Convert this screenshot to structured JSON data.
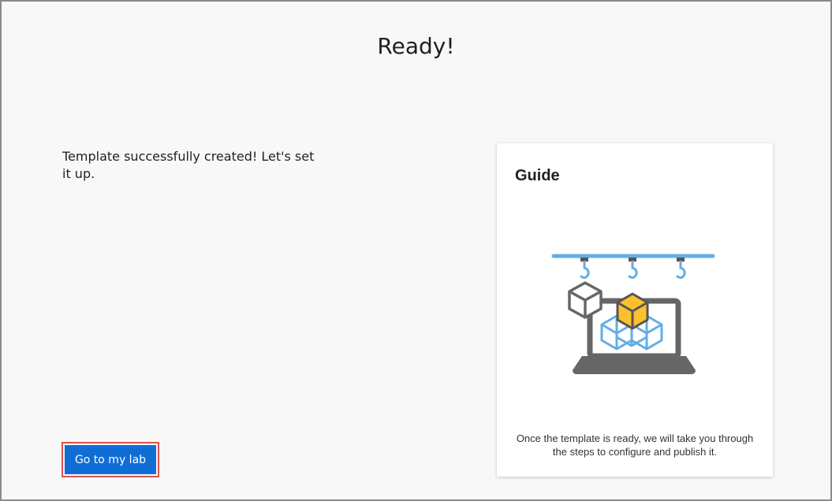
{
  "page": {
    "title": "Ready!",
    "message": "Template successfully created! Let's set it up.",
    "primary_button_label": "Go to my lab"
  },
  "guide": {
    "title": "Guide",
    "illustration_icon": "laptop-hooks-cubes-icon",
    "text": "Once the template is ready, we will take you through the steps to configure and publish it."
  },
  "colors": {
    "accent": "#0f6ed6",
    "highlight_border": "#d9534f",
    "illustration_blue": "#62aee5",
    "illustration_gray": "#666666",
    "illustration_yellow": "#fbc02d"
  }
}
